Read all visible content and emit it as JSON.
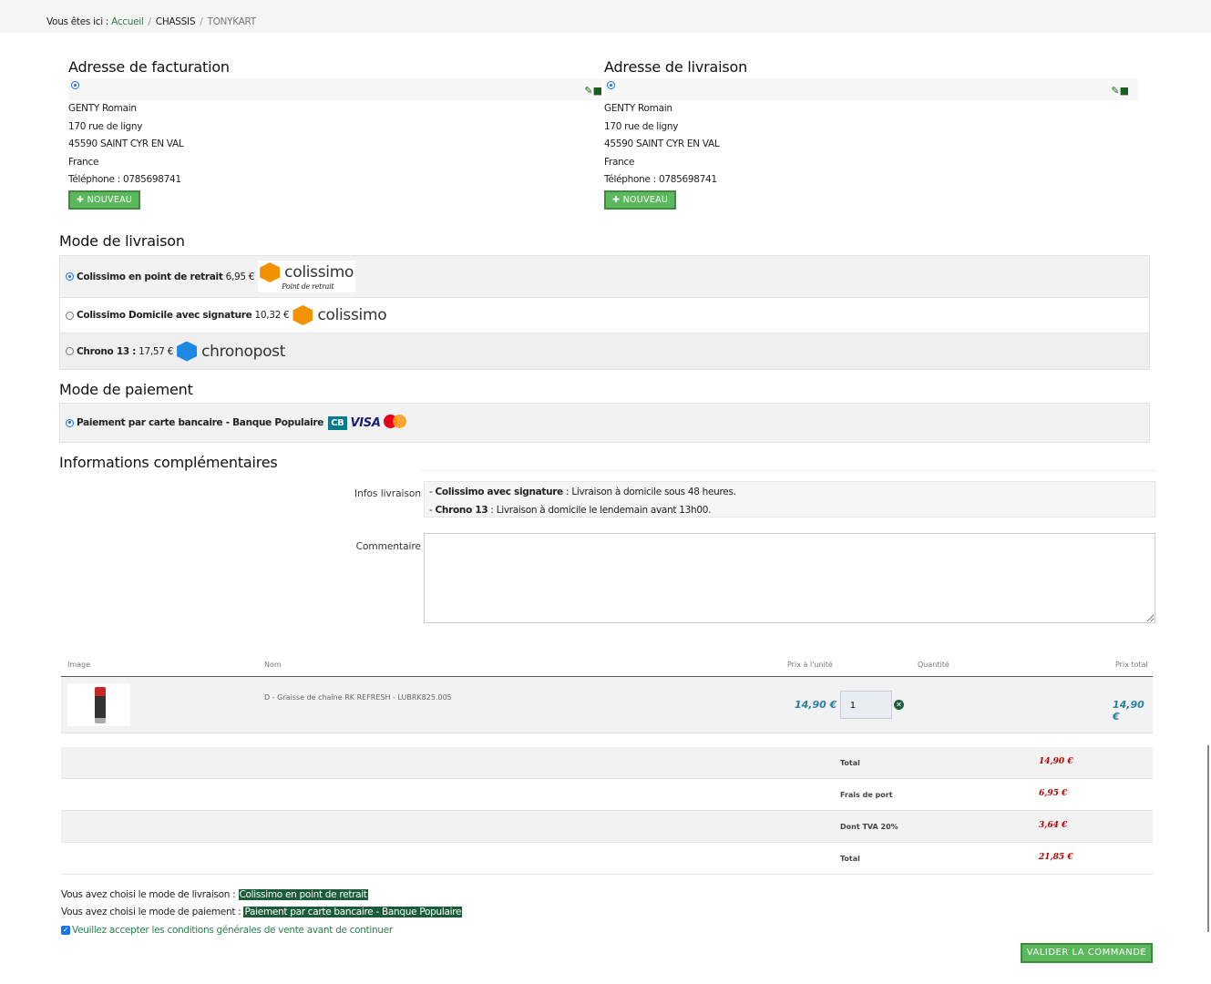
{
  "breadcrumb": {
    "prefix": "Vous êtes ici :",
    "items": [
      "Accueil",
      "CHASSIS",
      "TONYKART"
    ]
  },
  "billing": {
    "title": "Adresse de facturation",
    "lines": [
      "GENTY Romain",
      "170 rue de ligny",
      "45590 SAINT CYR EN VAL",
      "France",
      "Téléphone : 0785698741"
    ],
    "new_button": "NOUVEAU"
  },
  "shipping_address": {
    "title": "Adresse de livraison",
    "lines": [
      "GENTY Romain",
      "170 rue de ligny",
      "45590 SAINT CYR EN VAL",
      "France",
      "Téléphone : 0785698741"
    ],
    "new_button": "NOUVEAU"
  },
  "delivery": {
    "title": "Mode de livraison",
    "options": [
      {
        "label": "Colissimo en point de retrait",
        "price": "6,95 €",
        "logo": "colissimo",
        "logo_sub": "Point de retrait",
        "selected": true
      },
      {
        "label": "Colissimo Domicile avec signature",
        "price": "10,32 €",
        "logo": "colissimo",
        "selected": false
      },
      {
        "label": "Chrono 13 :",
        "price": "17,57 €",
        "logo": "chronopost",
        "selected": false
      }
    ]
  },
  "payment": {
    "title": "Mode de paiement",
    "options": [
      {
        "label": "Paiement par carte bancaire - Banque Populaire",
        "logos": [
          "CB",
          "VISA",
          "mastercard"
        ],
        "selected": true
      }
    ]
  },
  "info": {
    "title": "Informations complémentaires",
    "infos_label": "Infos livraison",
    "infos": [
      {
        "bold": "Colissimo avec signature",
        "text": " : Livraison à domicile sous 48 heures."
      },
      {
        "bold": "Chrono 13",
        "text": " : Livraison à domicile le lendemain avant 13h00."
      }
    ],
    "comment_label": "Commentaire",
    "comment_value": ""
  },
  "cart": {
    "headers": [
      "Image",
      "Nom",
      "Prix à l'unité",
      "Quantité",
      "Prix total"
    ],
    "items": [
      {
        "name": "D - Graisse de chaîne RK REFRESH  - LUBRK825.005",
        "unit_price": "14,90 €",
        "quantity": "1",
        "total": "14,90 €"
      }
    ],
    "totals": [
      {
        "label": "Total",
        "value": "14,90 €"
      },
      {
        "label": "Frais de port",
        "value": "6,95 €"
      },
      {
        "label": "Dont TVA 20%",
        "value": "3,64 €"
      },
      {
        "label": "Total",
        "value": "21,85 €"
      }
    ]
  },
  "summary": {
    "delivery_prefix": "Vous avez choisi le mode de livraison :",
    "delivery_value": "Colissimo en point de retrait",
    "payment_prefix": "Vous avez choisi le mode de paiement :",
    "payment_value": "Paiement par carte bancaire - Banque Populaire",
    "cgv_label": "Veuillez accepter les conditions générales de vente avant de continuer",
    "cgv_checked": true,
    "validate_button": "VALIDER LA COMMANDE"
  },
  "colors": {
    "green": "#5cb85c",
    "dark_green": "#1a5c3a",
    "price_blue": "#2a7fa0",
    "total_red": "#b00000"
  }
}
